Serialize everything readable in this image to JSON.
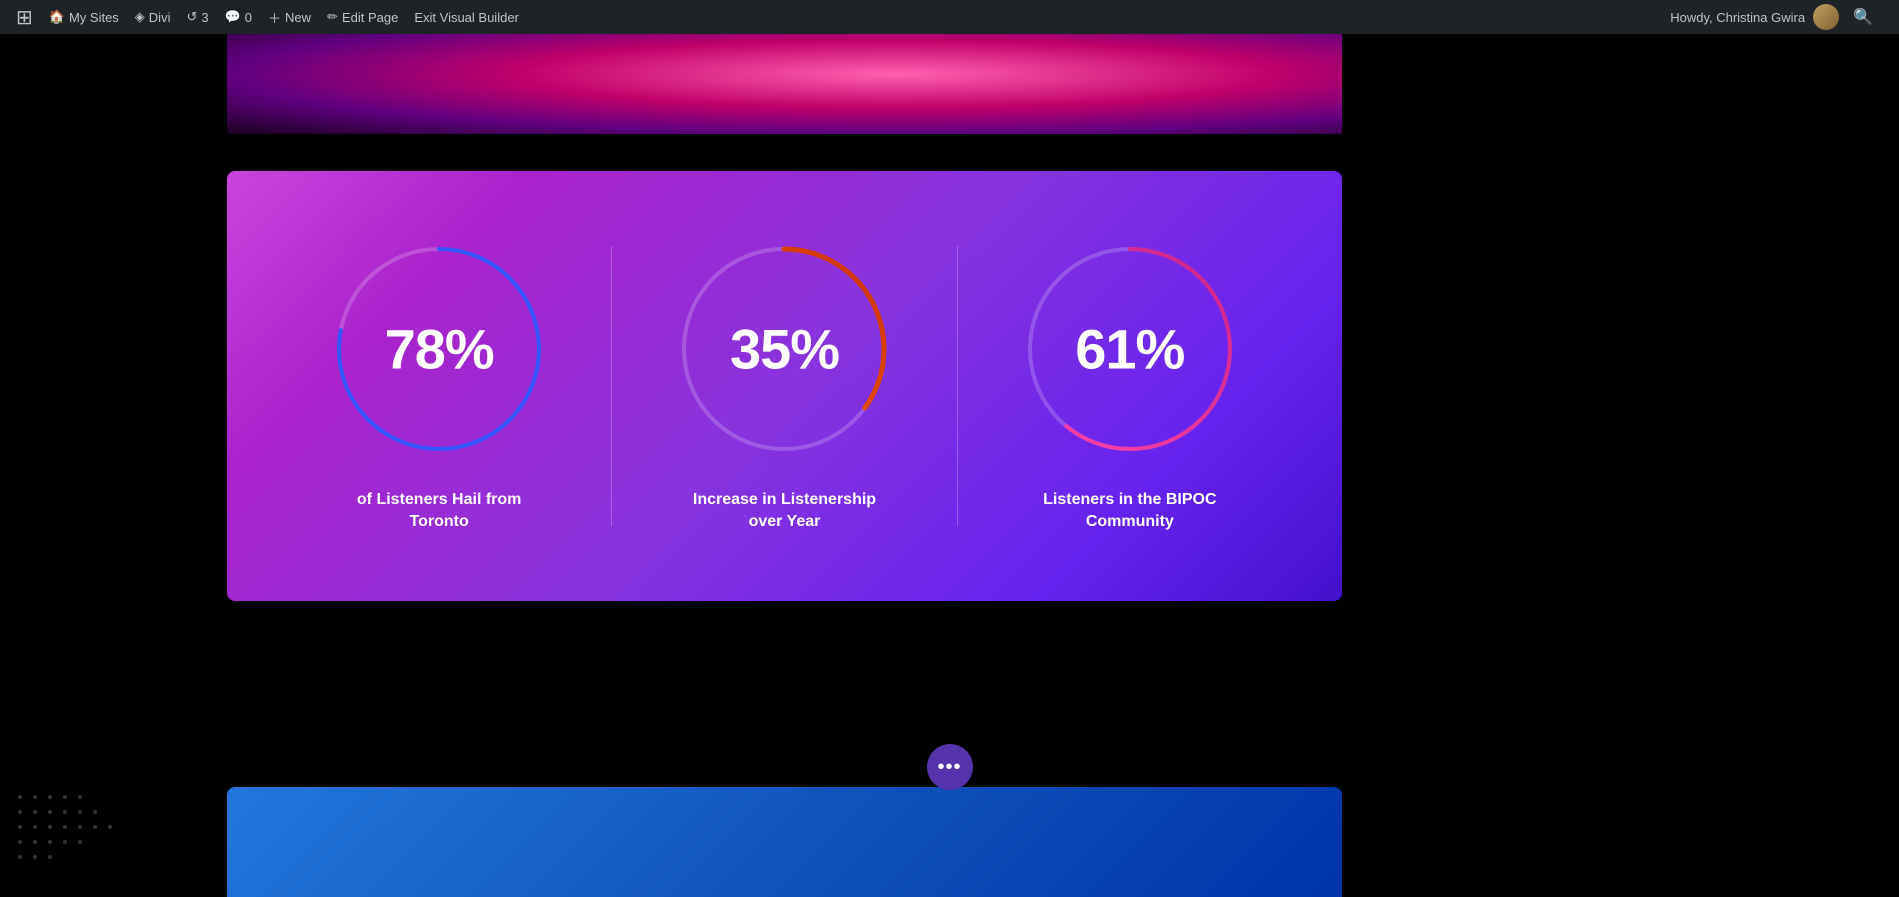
{
  "adminBar": {
    "wpLogo": "⊞",
    "mySites": "My Sites",
    "divi": "Divi",
    "updates": "3",
    "comments": "0",
    "new": "New",
    "editPage": "Edit Page",
    "exitVisualBuilder": "Exit Visual Builder",
    "user": "Howdy, Christina Gwira",
    "searchIcon": "🔍"
  },
  "stats": [
    {
      "id": "stat-toronto",
      "value": "78%",
      "label": "of Listeners Hail from Toronto",
      "percent": 78,
      "strokeColor": "#3355ff"
    },
    {
      "id": "stat-listenership",
      "value": "35%",
      "label": "Increase in Listenership over Year",
      "percent": 35,
      "strokeColor": "orange-gradient"
    },
    {
      "id": "stat-bipoc",
      "value": "61%",
      "label": "Listeners in the BIPOC Community",
      "percent": 61,
      "strokeColor": "pink-gradient"
    }
  ],
  "dotsButton": {
    "label": "•••"
  }
}
